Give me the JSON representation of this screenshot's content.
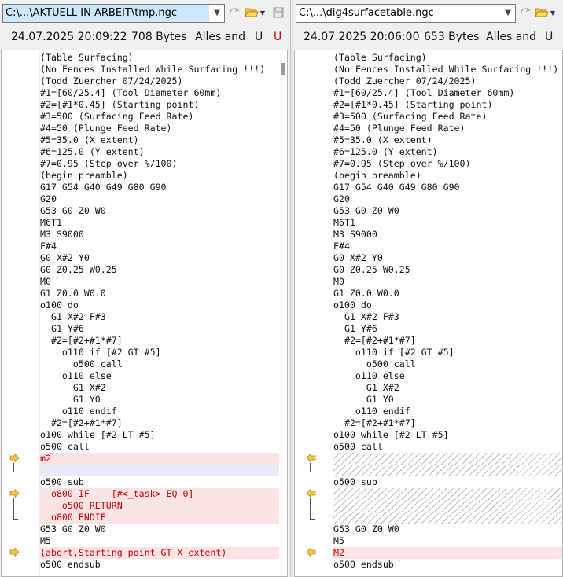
{
  "left": {
    "path": "C:\\...\\AKTUELL IN ARBEIT\\tmp.ngc",
    "timestamp": "24.07.2025 20:09:22",
    "size": "708 Bytes",
    "encoding": "Alles and",
    "u1": "U",
    "u2": "U",
    "lines": [
      {
        "t": "(Table Surfacing)",
        "s": "n"
      },
      {
        "t": "(No Fences Installed While Surfacing !!!)",
        "s": "n"
      },
      {
        "t": "(Todd Zuercher 07/24/2025)",
        "s": "n"
      },
      {
        "t": "#1=[60/25.4] (Tool Diameter 60mm)",
        "s": "n"
      },
      {
        "t": "#2=[#1*0.45] (Starting point)",
        "s": "n"
      },
      {
        "t": "#3=500 (Surfacing Feed Rate)",
        "s": "n"
      },
      {
        "t": "#4=50 (Plunge Feed Rate)",
        "s": "n"
      },
      {
        "t": "#5=35.0 (X extent)",
        "s": "n"
      },
      {
        "t": "#6=125.0 (Y extent)",
        "s": "n"
      },
      {
        "t": "#7=0.95 (Step over %/100)",
        "s": "n"
      },
      {
        "t": "(begin preamble)",
        "s": "n"
      },
      {
        "t": "G17 G54 G40 G49 G80 G90",
        "s": "n"
      },
      {
        "t": "G20",
        "s": "n"
      },
      {
        "t": "G53 G0 Z0 W0",
        "s": "n"
      },
      {
        "t": "M6T1",
        "s": "n"
      },
      {
        "t": "M3 S9000",
        "s": "n"
      },
      {
        "t": "F#4",
        "s": "n"
      },
      {
        "t": "G0 X#2 Y0",
        "s": "n"
      },
      {
        "t": "G0 Z0.25 W0.25",
        "s": "n"
      },
      {
        "t": "M0",
        "s": "n"
      },
      {
        "t": "G1 Z0.0 W0.0",
        "s": "n"
      },
      {
        "t": "o100 do",
        "s": "n"
      },
      {
        "t": "  G1 X#2 F#3",
        "s": "n"
      },
      {
        "t": "  G1 Y#6",
        "s": "n"
      },
      {
        "t": "  #2=[#2+#1*#7]",
        "s": "n"
      },
      {
        "t": "    o110 if [#2 GT #5]",
        "s": "n"
      },
      {
        "t": "      o500 call",
        "s": "n"
      },
      {
        "t": "    o110 else",
        "s": "n"
      },
      {
        "t": "      G1 X#2",
        "s": "n"
      },
      {
        "t": "      G1 Y0",
        "s": "n"
      },
      {
        "t": "    o110 endif",
        "s": "n"
      },
      {
        "t": "  #2=[#2+#1*#7]",
        "s": "n"
      },
      {
        "t": "o100 while [#2 LT #5]",
        "s": "n"
      },
      {
        "t": "o500 call",
        "s": "n"
      },
      {
        "t": "m2",
        "s": "d"
      },
      {
        "t": "",
        "s": "b"
      },
      {
        "t": "o500 sub",
        "s": "n"
      },
      {
        "t": "  o800 IF    [#<_task> EQ 0]",
        "s": "d"
      },
      {
        "t": "    o500 RETURN",
        "s": "d"
      },
      {
        "t": "  o800 ENDIF",
        "s": "d"
      },
      {
        "t": "G53 G0 Z0 W0",
        "s": "n"
      },
      {
        "t": "M5",
        "s": "n"
      },
      {
        "t": "(abort,Starting point GT X extent)",
        "s": "d"
      },
      {
        "t": "o500 endsub",
        "s": "n"
      }
    ]
  },
  "right": {
    "path": "C:\\...\\dig4surfacetable.ngc",
    "timestamp": "24.07.2025 20:06:00",
    "size": "653 Bytes",
    "encoding": "Alles and",
    "u1": "U",
    "lines": [
      {
        "t": "(Table Surfacing)",
        "s": "n"
      },
      {
        "t": "(No Fences Installed While Surfacing !!!)",
        "s": "n"
      },
      {
        "t": "(Todd Zuercher 07/24/2025)",
        "s": "n"
      },
      {
        "t": "#1=[60/25.4] (Tool Diameter 60mm)",
        "s": "n"
      },
      {
        "t": "#2=[#1*0.45] (Starting point)",
        "s": "n"
      },
      {
        "t": "#3=500 (Surfacing Feed Rate)",
        "s": "n"
      },
      {
        "t": "#4=50 (Plunge Feed Rate)",
        "s": "n"
      },
      {
        "t": "#5=35.0 (X extent)",
        "s": "n"
      },
      {
        "t": "#6=125.0 (Y extent)",
        "s": "n"
      },
      {
        "t": "#7=0.95 (Step over %/100)",
        "s": "n"
      },
      {
        "t": "(begin preamble)",
        "s": "n"
      },
      {
        "t": "G17 G54 G40 G49 G80 G90",
        "s": "n"
      },
      {
        "t": "G20",
        "s": "n"
      },
      {
        "t": "G53 G0 Z0 W0",
        "s": "n"
      },
      {
        "t": "M6T1",
        "s": "n"
      },
      {
        "t": "M3 S9000",
        "s": "n"
      },
      {
        "t": "F#4",
        "s": "n"
      },
      {
        "t": "G0 X#2 Y0",
        "s": "n"
      },
      {
        "t": "G0 Z0.25 W0.25",
        "s": "n"
      },
      {
        "t": "M0",
        "s": "n"
      },
      {
        "t": "G1 Z0.0 W0.0",
        "s": "n"
      },
      {
        "t": "o100 do",
        "s": "n"
      },
      {
        "t": "  G1 X#2 F#3",
        "s": "n"
      },
      {
        "t": "  G1 Y#6",
        "s": "n"
      },
      {
        "t": "  #2=[#2+#1*#7]",
        "s": "n"
      },
      {
        "t": "    o110 if [#2 GT #5]",
        "s": "n"
      },
      {
        "t": "      o500 call",
        "s": "n"
      },
      {
        "t": "    o110 else",
        "s": "n"
      },
      {
        "t": "      G1 X#2",
        "s": "n"
      },
      {
        "t": "      G1 Y0",
        "s": "n"
      },
      {
        "t": "    o110 endif",
        "s": "n"
      },
      {
        "t": "  #2=[#2+#1*#7]",
        "s": "n"
      },
      {
        "t": "o100 while [#2 LT #5]",
        "s": "n"
      },
      {
        "t": "o500 call",
        "s": "n"
      },
      {
        "t": "",
        "s": "g"
      },
      {
        "t": "",
        "s": "g"
      },
      {
        "t": "o500 sub",
        "s": "n"
      },
      {
        "t": "",
        "s": "g"
      },
      {
        "t": "",
        "s": "g"
      },
      {
        "t": "",
        "s": "g"
      },
      {
        "t": "G53 G0 Z0 W0",
        "s": "n"
      },
      {
        "t": "M5",
        "s": "n"
      },
      {
        "t": "M2",
        "s": "d"
      },
      {
        "t": "o500 endsub",
        "s": "n"
      }
    ]
  },
  "colors": {
    "diff_bg": "#fde4e4",
    "diff_text": "#d00000",
    "marker": "#d4a800",
    "selection": "#cce8ff"
  },
  "icons": [
    "chevron-down-icon",
    "sync-arrow-icon",
    "open-folder-icon",
    "save-icon"
  ]
}
